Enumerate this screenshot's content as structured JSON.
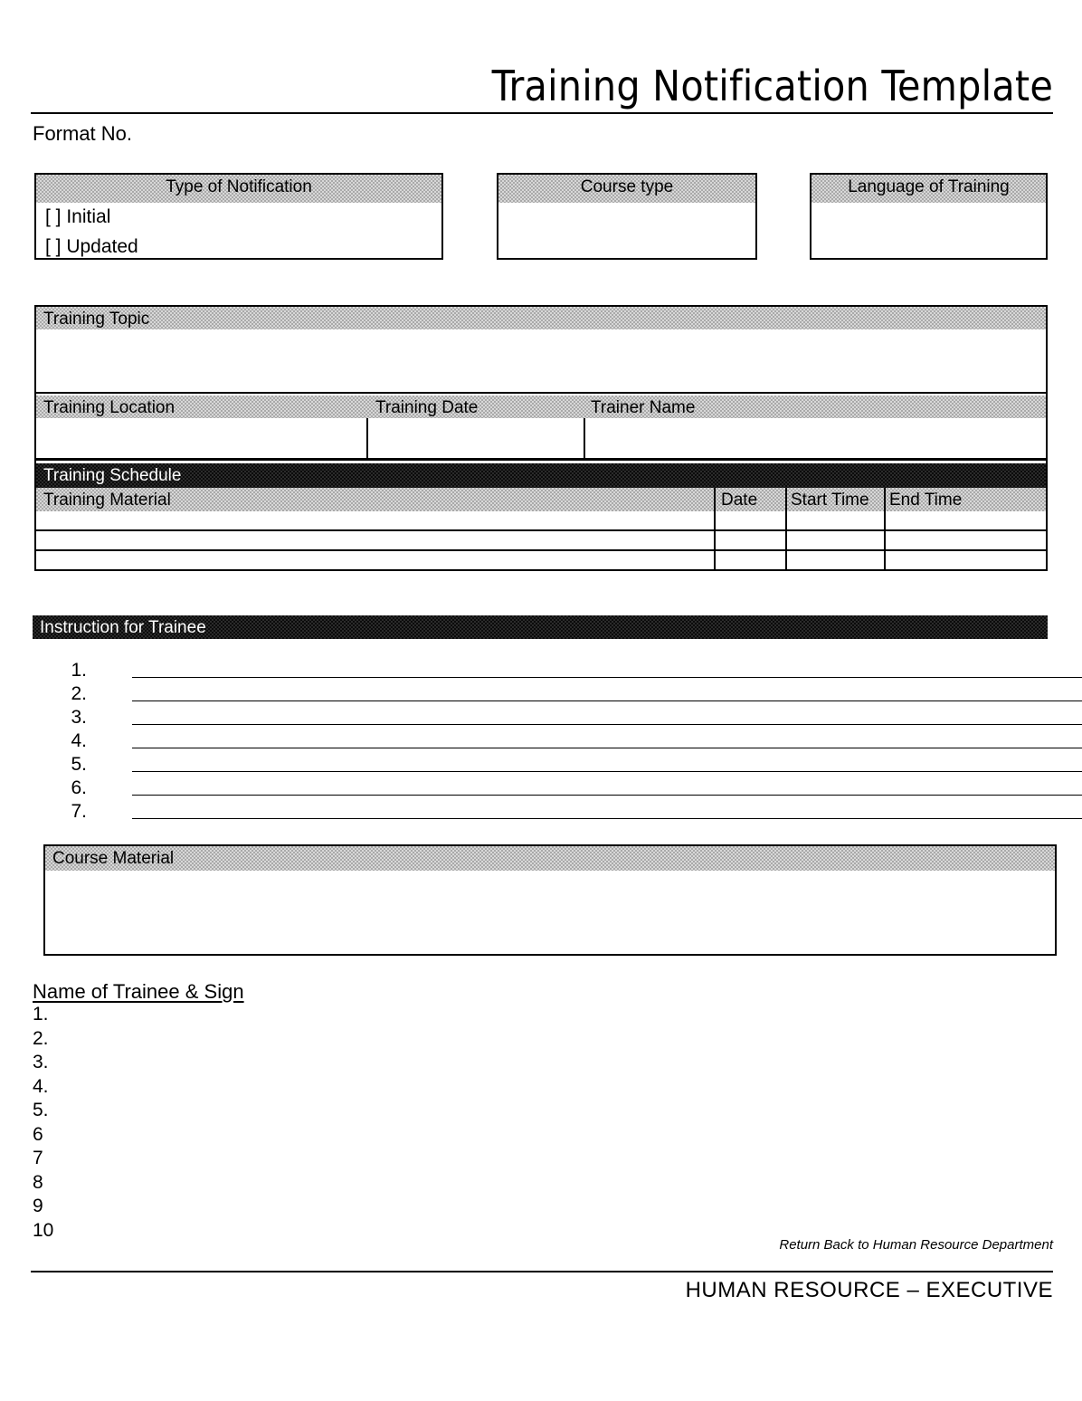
{
  "document": {
    "title": "Training Notification Template",
    "format_no_label": "Format No."
  },
  "notification": {
    "header": "Type of Notification",
    "options": [
      "[          ] Initial",
      "[          ] Updated"
    ]
  },
  "course_type": {
    "header": "Course type",
    "value": ""
  },
  "language": {
    "header": "Language of Training",
    "value": ""
  },
  "training": {
    "topic_header": "Training Topic",
    "topic_value": "",
    "location_header": "Training Location",
    "location_value": "",
    "date_header": "Training Date",
    "date_value": "",
    "trainer_header": "Trainer Name",
    "trainer_value": "",
    "schedule_header": "Training Schedule",
    "material_columns": [
      "Training Material",
      "Date",
      "Start Time",
      "End Time"
    ],
    "material_rows": [
      {
        "material": "",
        "date": "",
        "start_time": "",
        "end_time": ""
      },
      {
        "material": "",
        "date": "",
        "start_time": "",
        "end_time": ""
      },
      {
        "material": "",
        "date": "",
        "start_time": "",
        "end_time": ""
      }
    ]
  },
  "instructions": {
    "header": "Instruction for Trainee",
    "items": [
      "1.",
      "2.",
      "3.",
      "4.",
      "5.",
      "6.",
      "7."
    ]
  },
  "course_material": {
    "header": "Course Material",
    "value": ""
  },
  "trainees": {
    "header": "Name of Trainee & Sign",
    "items": [
      "1.",
      "2.",
      "3.",
      "4.",
      "5.",
      "6",
      "7",
      "8",
      "9",
      "10"
    ]
  },
  "footer": {
    "return_note": "Return Back to Human Resource Department",
    "signatory": "HUMAN RESOURCE – EXECUTIVE"
  },
  "colors": {
    "header_grey": "#a9a9a9",
    "header_black": "#0b0b0b",
    "border": "#000000",
    "page": "#ffffff"
  }
}
